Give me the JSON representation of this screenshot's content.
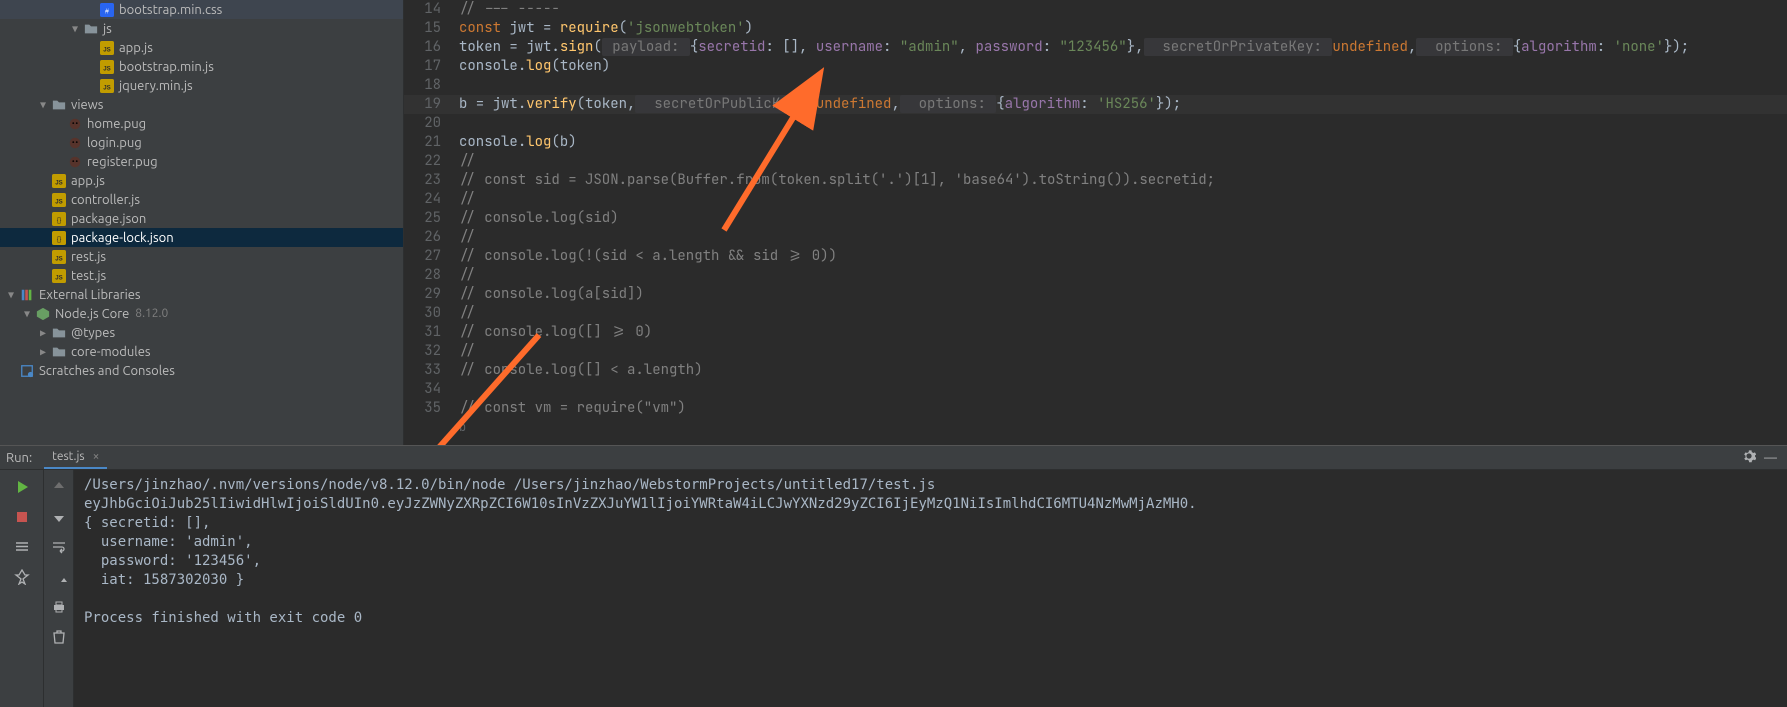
{
  "tree": [
    {
      "indent": 5,
      "arrow": "",
      "icon": "css",
      "label": "bootstrap.min.css"
    },
    {
      "indent": 4,
      "arrow": "▼",
      "icon": "folder",
      "label": "js"
    },
    {
      "indent": 5,
      "arrow": "",
      "icon": "js",
      "label": "app.js"
    },
    {
      "indent": 5,
      "arrow": "",
      "icon": "js",
      "label": "bootstrap.min.js"
    },
    {
      "indent": 5,
      "arrow": "",
      "icon": "js",
      "label": "jquery.min.js"
    },
    {
      "indent": 2,
      "arrow": "▼",
      "icon": "folder",
      "label": "views"
    },
    {
      "indent": 3,
      "arrow": "",
      "icon": "pug",
      "label": "home.pug"
    },
    {
      "indent": 3,
      "arrow": "",
      "icon": "pug",
      "label": "login.pug"
    },
    {
      "indent": 3,
      "arrow": "",
      "icon": "pug",
      "label": "register.pug"
    },
    {
      "indent": 2,
      "arrow": "",
      "icon": "js",
      "label": "app.js"
    },
    {
      "indent": 2,
      "arrow": "",
      "icon": "js",
      "label": "controller.js"
    },
    {
      "indent": 2,
      "arrow": "",
      "icon": "json",
      "label": "package.json"
    },
    {
      "indent": 2,
      "arrow": "",
      "icon": "json",
      "label": "package-lock.json",
      "selected": true
    },
    {
      "indent": 2,
      "arrow": "",
      "icon": "js",
      "label": "rest.js"
    },
    {
      "indent": 2,
      "arrow": "",
      "icon": "js",
      "label": "test.js"
    },
    {
      "indent": 0,
      "arrow": "▼",
      "icon": "lib",
      "label": "External Libraries"
    },
    {
      "indent": 1,
      "arrow": "▼",
      "icon": "node",
      "label": "Node.js Core",
      "dim": "8.12.0"
    },
    {
      "indent": 2,
      "arrow": "▶",
      "icon": "folder",
      "label": "@types"
    },
    {
      "indent": 2,
      "arrow": "▶",
      "icon": "folder",
      "label": "core-modules"
    },
    {
      "indent": 0,
      "arrow": "",
      "icon": "scratch",
      "label": "Scratches and Consoles"
    }
  ],
  "code": {
    "start": 14,
    "lines": [
      {
        "n": 14,
        "t": "top"
      },
      {
        "n": 15,
        "t": "l15"
      },
      {
        "n": 16,
        "t": "l16"
      },
      {
        "n": 17,
        "t": "l17"
      },
      {
        "n": 18,
        "t": "empty"
      },
      {
        "n": 19,
        "t": "l19",
        "hl": true
      },
      {
        "n": 20,
        "t": "empty"
      },
      {
        "n": 21,
        "t": "l21"
      },
      {
        "n": 22,
        "t": "c",
        "c": "//"
      },
      {
        "n": 23,
        "t": "c",
        "c": "// const sid = JSON.parse(Buffer.from(token.split('.')[1], 'base64').toString()).secretid;"
      },
      {
        "n": 24,
        "t": "c",
        "c": "//"
      },
      {
        "n": 25,
        "t": "c",
        "c": "// console.log(sid)"
      },
      {
        "n": 26,
        "t": "c",
        "c": "//"
      },
      {
        "n": 27,
        "t": "c",
        "c": "// console.log(!(sid < a.length && sid >= 0))"
      },
      {
        "n": 28,
        "t": "c",
        "c": "//"
      },
      {
        "n": 29,
        "t": "c",
        "c": "// console.log(a[sid])"
      },
      {
        "n": 30,
        "t": "c",
        "c": "//"
      },
      {
        "n": 31,
        "t": "c",
        "c": "// console.log([] >= 0)"
      },
      {
        "n": 32,
        "t": "c",
        "c": "//"
      },
      {
        "n": 33,
        "t": "c",
        "c": "// console.log([] < a.length)"
      },
      {
        "n": 34,
        "t": "empty"
      },
      {
        "n": 35,
        "t": "c",
        "c": "// const vm = require(\"vm\")"
      }
    ],
    "l15": {
      "kw": "const",
      "id": "jwt",
      "eq": " = ",
      "fn": "require",
      "paren": "(",
      "str": "'jsonwebtoken'",
      "close": ")"
    },
    "l16": {
      "id": "token",
      "eq": " = ",
      "obj": "jwt",
      "dot": ".",
      "fn": "sign",
      "paren": "(",
      "h1": " payload: ",
      "brace": "{",
      "p1": "secretid",
      "p1v": ": [], ",
      "p2": "username",
      "p2v": ": ",
      "s2": "\"admin\"",
      "c2": ", ",
      "p3": "password",
      "p3v": ": ",
      "s3": "\"123456\"",
      "bend": "},",
      "h2": "  secretOrPrivateKey: ",
      "und": "undefined",
      "cm": ",",
      "h3": "  options: ",
      "b2": "{",
      "p4": "algorithm",
      "cln": ": ",
      "s4": "'none'",
      "end": "});"
    },
    "l17": {
      "obj": "console",
      "dot": ".",
      "fn": "log",
      "paren": "(",
      "arg": "token",
      "close": ")"
    },
    "l19": {
      "id": "b",
      "eq": " = ",
      "obj": "jwt",
      "dot": ".",
      "fn": "verify",
      "paren": "(",
      "a1": "token",
      "cm": ",",
      "h1": "  secretOrPublicKey: ",
      "und": "undefined",
      "cm2": ",",
      "h2": "  options: ",
      "brace": "{",
      "p1": "algorithm",
      "cln": ": ",
      "s1": "'HS256'",
      "end": "});"
    },
    "l21": {
      "obj": "console",
      "dot": ".",
      "fn": "log",
      "paren": "(",
      "arg": "b",
      "close": ")"
    },
    "status": "b"
  },
  "run": {
    "label": "Run:",
    "tab": "test.js",
    "lines": [
      "/Users/jinzhao/.nvm/versions/node/v8.12.0/bin/node /Users/jinzhao/WebstormProjects/untitled17/test.js",
      "eyJhbGciOiJub25lIiwidHlwIjoiSldUIn0.eyJzZWNyZXRpZCI6W10sInVzZXJuYW1lIjoiYWRtaW4iLCJwYXNzd29yZCI6IjEyMzQ1NiIsImlhdCI6MTU4NzMwMjAzMH0.",
      "{ secretid: [],",
      "  username: 'admin',",
      "  password: '123456',",
      "  iat: 1587302030 }",
      "",
      "Process finished with exit code 0"
    ]
  },
  "annotation_arrows": {
    "color": "#ff6b2b"
  }
}
